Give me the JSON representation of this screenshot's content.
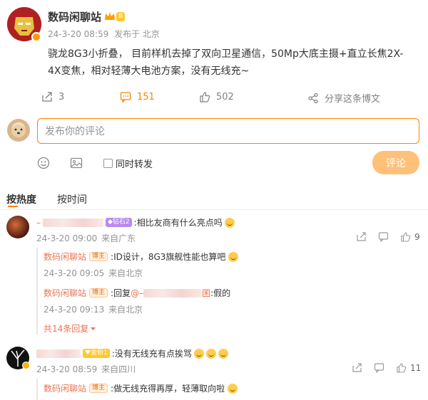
{
  "post": {
    "author": "数码闲聊站",
    "timestamp": "24-3-20 08:59",
    "location": "发布于 北京",
    "text_line1": "骁龙8G3小折叠，  目前样机去掉了双向卫星通信，50Mp大底主摄+直立长焦2X-",
    "text_line2": "4X变焦，相对轻薄大电池方案，没有无线充~",
    "member_badge": "Ⅲ",
    "actions": {
      "repost_count": "3",
      "comment_count": "151",
      "like_count": "502",
      "share_label": "分享这条博文"
    }
  },
  "comment_box": {
    "placeholder": "发布你的评论",
    "repost_label": "同时转发",
    "submit_label": "评论"
  },
  "tabs": {
    "hot": "按热度",
    "time": "按时间"
  },
  "comments": [
    {
      "name_suffix": "",
      "badge": "钻石2",
      "text": ":相比友商有什么亮点吗",
      "timestamp": "24-3-20 09:00",
      "location": "来自广东",
      "likes": "9",
      "replies": [
        {
          "author": "数码闲聊站",
          "badge": "博主",
          "text": ":ID设计，8G3旗舰性能也算吧",
          "timestamp": "24-3-20 09:05",
          "location": "来自北京"
        },
        {
          "author": "数码闲聊站",
          "badge": "博主",
          "text_prefix": ":回复",
          "mention": "@–",
          "mention_end": "囷",
          "text_suffix": ":假的",
          "timestamp": "24-3-20 09:13",
          "location": "来自北京"
        }
      ],
      "more_replies": "共14条回复"
    },
    {
      "badge": "金粉1",
      "text": ":没有无线充有点挨骂",
      "timestamp": "24-3-20 08:59",
      "location": "来自四川",
      "likes": "11",
      "replies": [
        {
          "author": "数码闲聊站",
          "badge": "博主",
          "text": ":做无线充得再厚，轻薄取向啦"
        }
      ]
    }
  ],
  "colors": {
    "accent": "#ff8200",
    "name_link": "#eb7350",
    "meta": "#939393"
  }
}
